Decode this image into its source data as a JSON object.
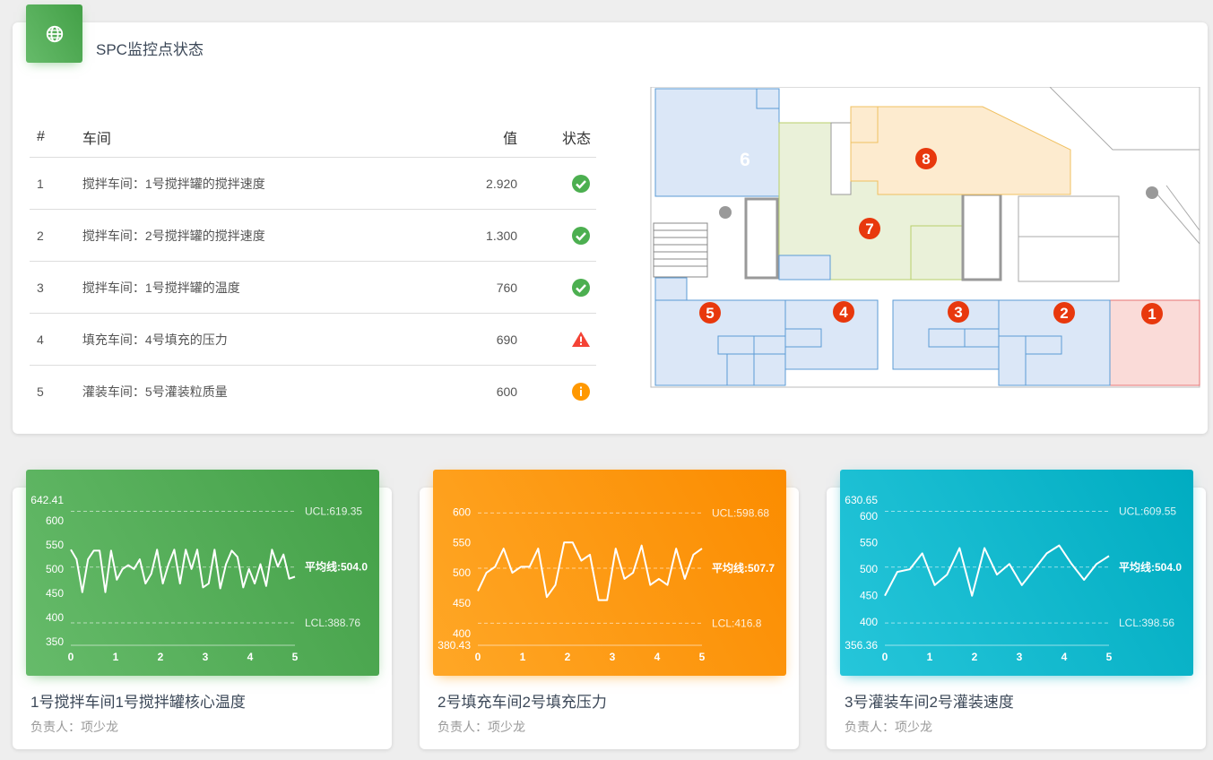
{
  "panel": {
    "title": "SPC监控点状态",
    "icon": "globe-icon",
    "table": {
      "headers": [
        "#",
        "车间",
        "值",
        "状态"
      ],
      "rows": [
        {
          "idx": "1",
          "name": "搅拌车间：1号搅拌罐的搅拌速度",
          "value": "2.920",
          "status": "ok"
        },
        {
          "idx": "2",
          "name": "搅拌车间：2号搅拌罐的搅拌速度",
          "value": "1.300",
          "status": "ok"
        },
        {
          "idx": "3",
          "name": "搅拌车间：1号搅拌罐的温度",
          "value": "760",
          "status": "ok"
        },
        {
          "idx": "4",
          "name": "填充车间：4号填充的压力",
          "value": "690",
          "status": "alarm"
        },
        {
          "idx": "5",
          "name": "灌装车间：5号灌装粒质量",
          "value": "600",
          "status": "info"
        }
      ]
    },
    "status_colors": {
      "ok": "#4caf50",
      "alarm": "#f44336",
      "info": "#ff9800"
    },
    "floorplan": {
      "markers": [
        "1",
        "2",
        "3",
        "4",
        "5",
        "6",
        "7",
        "8"
      ]
    }
  },
  "charts": [
    {
      "title": "1号搅拌车间1号搅拌罐核心温度",
      "owner": "负责人：项少龙",
      "color": "green",
      "chart_data": {
        "type": "line",
        "ylim": [
          342.41,
          642.41
        ],
        "yticks": [
          "642.41",
          "600",
          "550",
          "500",
          "450",
          "400",
          "350"
        ],
        "xticks": [
          "0",
          "1",
          "2",
          "3",
          "4",
          "5"
        ],
        "ucl_label": "UCL:619.35",
        "lcl_label": "LCL:388.76",
        "avg_label": "平均线:504.0",
        "ucl": 619.35,
        "lcl": 388.76,
        "avg": 504.0,
        "values": [
          540,
          520,
          452,
          520,
          538,
          538,
          452,
          538,
          478,
          500,
          508,
          500,
          520,
          470,
          490,
          540,
          470,
          510,
          540,
          470,
          540,
          500,
          540,
          462,
          470,
          540,
          460,
          510,
          538,
          525,
          462,
          500,
          470,
          510,
          465,
          540,
          505,
          530,
          480,
          484
        ]
      }
    },
    {
      "title": "2号填充车间2号填充压力",
      "owner": "负责人：项少龙",
      "color": "orange",
      "chart_data": {
        "type": "line",
        "ylim": [
          380.43,
          620
        ],
        "yticks": [
          "600",
          "550",
          "500",
          "450",
          "400",
          "380.43"
        ],
        "xticks": [
          "0",
          "1",
          "2",
          "3",
          "4",
          "5"
        ],
        "ucl_label": "UCL:598.68",
        "lcl_label": "LCL:416.8",
        "avg_label": "平均线:507.7",
        "ucl": 598.68,
        "lcl": 416.8,
        "avg": 507.7,
        "values": [
          470,
          500,
          510,
          540,
          500,
          510,
          510,
          540,
          460,
          480,
          550,
          550,
          520,
          530,
          455,
          455,
          540,
          490,
          500,
          545,
          480,
          490,
          480,
          540,
          490,
          530,
          540
        ]
      }
    },
    {
      "title": "3号灌装车间2号灌装速度",
      "owner": "负责人：项少龙",
      "color": "cyan",
      "chart_data": {
        "type": "line",
        "ylim": [
          356.36,
          630.65
        ],
        "yticks": [
          "630.65",
          "600",
          "550",
          "500",
          "450",
          "400",
          "356.36"
        ],
        "xticks": [
          "0",
          "1",
          "2",
          "3",
          "4",
          "5"
        ],
        "ucl_label": "UCL:609.55",
        "lcl_label": "LCL:398.56",
        "avg_label": "平均线:504.0",
        "ucl": 609.55,
        "lcl": 398.56,
        "avg": 504.0,
        "values": [
          450,
          495,
          500,
          530,
          470,
          490,
          540,
          450,
          540,
          490,
          510,
          470,
          500,
          530,
          545,
          510,
          480,
          510,
          525
        ]
      }
    }
  ]
}
